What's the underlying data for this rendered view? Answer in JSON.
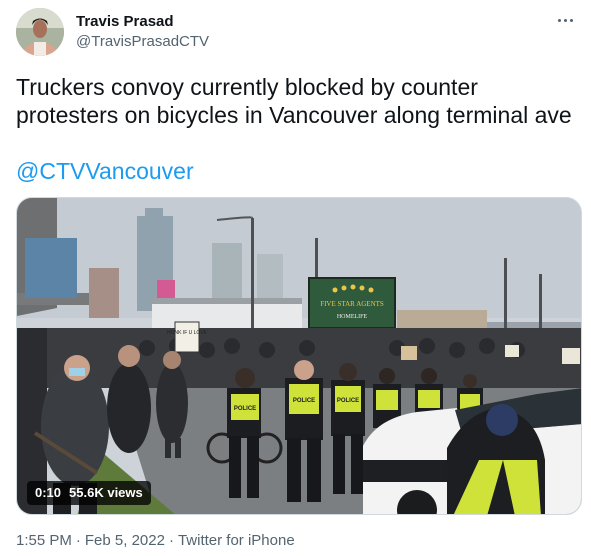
{
  "author": {
    "display_name": "Travis Prasad",
    "handle": "@TravisPrasadCTV"
  },
  "tweet": {
    "text": "Truckers convoy currently blocked by counter protesters on bicycles in Vancouver along terminal ave",
    "mention": "@CTVVancouver"
  },
  "video": {
    "elapsed": "0:10",
    "views": "55.6K views",
    "signs": {
      "billboard_line1": "FIVE STAR AGENTS",
      "billboard_line2": "HOMELIFE",
      "protest_sign": "HONK IF U LOVE"
    },
    "vest_label": "POLICE"
  },
  "meta": {
    "time": "1:55 PM",
    "separator1": "·",
    "date": "Feb 5, 2022",
    "separator2": "·",
    "source": "Twitter for iPhone"
  },
  "icons": {
    "more": "more-dots-icon"
  },
  "colors": {
    "link": "#1d9bf0",
    "secondary_text": "#536471",
    "billboard": "#2f5a3c"
  }
}
